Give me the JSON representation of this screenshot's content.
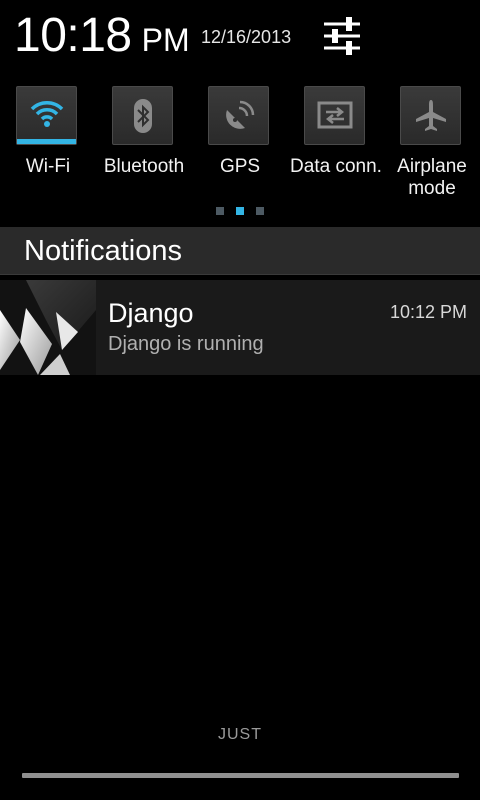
{
  "status": {
    "time": "10:18",
    "ampm": "PM",
    "date": "12/16/2013",
    "settings_icon": "settings-sliders-icon"
  },
  "quick_settings": {
    "toggles": [
      {
        "label": "Wi-Fi",
        "icon": "wifi-icon",
        "active": true
      },
      {
        "label": "Bluetooth",
        "icon": "bluetooth-icon",
        "active": false
      },
      {
        "label": "GPS",
        "icon": "gps-satellite-icon",
        "active": false
      },
      {
        "label": "Data conn.",
        "icon": "data-transfer-icon",
        "active": false
      },
      {
        "label": "Airplane mode",
        "icon": "airplane-icon",
        "active": false
      }
    ],
    "pages": 3,
    "current_page": 2
  },
  "notifications": {
    "header": "Notifications",
    "items": [
      {
        "app": "Django",
        "text": "Django is running",
        "time": "10:12 PM",
        "icon": "django-app-icon"
      }
    ]
  },
  "carrier": "JUST",
  "colors": {
    "accent": "#33b5e5",
    "background": "#000000",
    "header_bar": "#2a2a2a",
    "item_bg": "#1a1a1a"
  }
}
